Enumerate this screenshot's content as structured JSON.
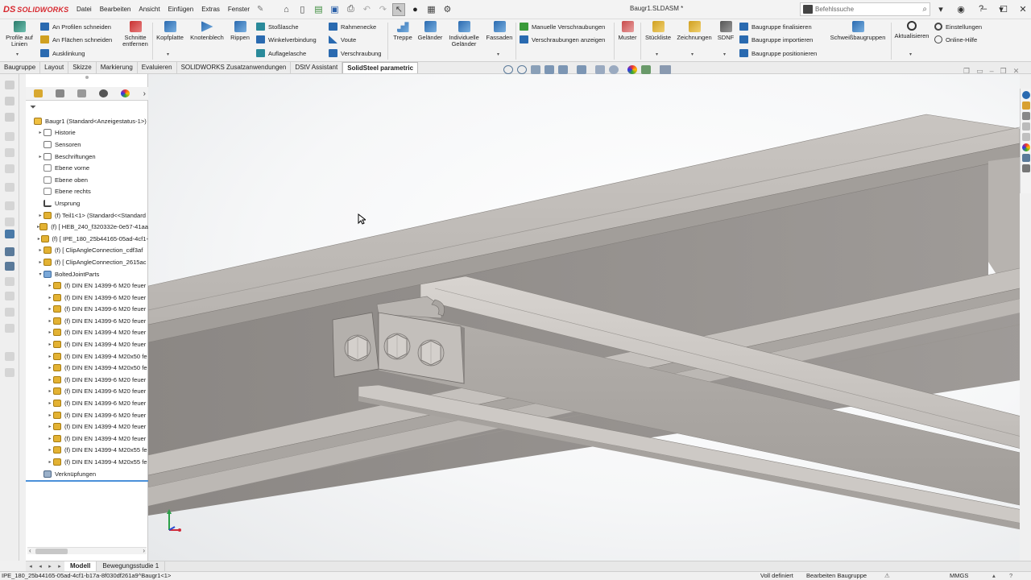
{
  "app": {
    "brand_ds": "DS",
    "brand_name": "SOLIDWORKS",
    "document_title": "Baugr1.SLDASM *",
    "search_placeholder": "Befehlssuche"
  },
  "menus": [
    "Datei",
    "Bearbeiten",
    "Ansicht",
    "Einfügen",
    "Extras",
    "Fenster"
  ],
  "ribbon": {
    "profile_from_lines": "Profile auf Linien",
    "cut_at_profiles": "An Profilen schneiden",
    "cut_at_faces": "An Flächen schneiden",
    "notch": "Ausklinkung",
    "remove_cuts": "Schnitte entfernen",
    "end_plate": "Kopfplatte",
    "gusset": "Knotenblech",
    "ribs": "Rippen",
    "splice": "Stoßlasche",
    "angle_connection": "Winkelverbindung",
    "bearing_plate": "Auflagelasche",
    "frame_corner": "Rahmenecke",
    "haunch": "Voute",
    "bracing": "Verschraubung",
    "stairs": "Treppe",
    "railing": "Geländer",
    "individual_railing": "Individuelle Geländer",
    "facades": "Fassaden",
    "manual_bolting": "Manuelle Verschraubungen",
    "show_bolting": "Verschraubungen anzeigen",
    "pattern": "Muster",
    "parts_list": "Stückliste",
    "drawings": "Zeichnungen",
    "sdnf": "SDNF",
    "finalize_assembly": "Baugruppe finalisieren",
    "import_assembly": "Baugruppe importieren",
    "position_assembly": "Baugruppe positionieren",
    "weld_assemblies": "Schweißbaugruppen",
    "update": "Aktualisieren",
    "settings": "Einstellungen",
    "online_help": "Online-Hilfe"
  },
  "command_tabs": [
    "Baugruppe",
    "Layout",
    "Skizze",
    "Markierung",
    "Evaluieren",
    "SOLIDWORKS Zusatzanwendungen",
    "DStV Assistant",
    "SolidSteel parametric"
  ],
  "active_command_tab": "SolidSteel parametric",
  "tree": [
    {
      "label": "Baugr1  (Standard<Anzeigestatus-1>)",
      "icon": "assembly-icon",
      "arrow": "",
      "indent": 0
    },
    {
      "label": "Historie",
      "icon": "history-icon",
      "arrow": "▸",
      "indent": 1
    },
    {
      "label": "Sensoren",
      "icon": "sensor-icon",
      "arrow": "",
      "indent": 1
    },
    {
      "label": "Beschriftungen",
      "icon": "annotation-icon",
      "arrow": "▸",
      "indent": 1
    },
    {
      "label": "Ebene vorne",
      "icon": "plane-icon",
      "arrow": "",
      "indent": 1
    },
    {
      "label": "Ebene oben",
      "icon": "plane-icon",
      "arrow": "",
      "indent": 1
    },
    {
      "label": "Ebene rechts",
      "icon": "plane-icon",
      "arrow": "",
      "indent": 1
    },
    {
      "label": "Ursprung",
      "icon": "origin-icon",
      "arrow": "",
      "indent": 1
    },
    {
      "label": "(f) Teil1<1> (Standard<<Standard",
      "icon": "part-icon",
      "arrow": "▸",
      "indent": 1
    },
    {
      "label": "(f) [ HEB_240_f320332e-0e57-41aa",
      "icon": "part-icon",
      "arrow": "▸",
      "indent": 1
    },
    {
      "label": "(f) [ IPE_180_25b44165-05ad-4cf1-",
      "icon": "part-icon",
      "arrow": "▸",
      "indent": 1
    },
    {
      "label": "(f) [ ClipAngleConnection_cdf3af",
      "icon": "part-icon",
      "arrow": "▸",
      "indent": 1
    },
    {
      "label": "(f) [ ClipAngleConnection_2615ac",
      "icon": "part-icon",
      "arrow": "▸",
      "indent": 1
    },
    {
      "label": "BoltedJointParts",
      "icon": "folder-icon",
      "arrow": "▾",
      "indent": 1
    },
    {
      "label": "(f) DIN EN 14399-6 M20 feuer",
      "icon": "part-icon",
      "arrow": "▸",
      "indent": 2
    },
    {
      "label": "(f) DIN EN 14399-6 M20 feuer",
      "icon": "part-icon",
      "arrow": "▸",
      "indent": 2
    },
    {
      "label": "(f) DIN EN 14399-6 M20 feuer",
      "icon": "part-icon",
      "arrow": "▸",
      "indent": 2
    },
    {
      "label": "(f) DIN EN 14399-6 M20 feuer",
      "icon": "part-icon",
      "arrow": "▸",
      "indent": 2
    },
    {
      "label": "(f) DIN EN 14399-4 M20 feuer",
      "icon": "part-icon",
      "arrow": "▸",
      "indent": 2
    },
    {
      "label": "(f) DIN EN 14399-4 M20 feuer",
      "icon": "part-icon",
      "arrow": "▸",
      "indent": 2
    },
    {
      "label": "(f) DIN EN 14399-4 M20x50 fe",
      "icon": "part-icon",
      "arrow": "▸",
      "indent": 2
    },
    {
      "label": "(f) DIN EN 14399-4 M20x50 fe",
      "icon": "part-icon",
      "arrow": "▸",
      "indent": 2
    },
    {
      "label": "(f) DIN EN 14399-6 M20 feuer",
      "icon": "part-icon",
      "arrow": "▸",
      "indent": 2
    },
    {
      "label": "(f) DIN EN 14399-6 M20 feuer",
      "icon": "part-icon",
      "arrow": "▸",
      "indent": 2
    },
    {
      "label": "(f) DIN EN 14399-6 M20 feuer",
      "icon": "part-icon",
      "arrow": "▸",
      "indent": 2
    },
    {
      "label": "(f) DIN EN 14399-6 M20 feuer",
      "icon": "part-icon",
      "arrow": "▸",
      "indent": 2
    },
    {
      "label": "(f) DIN EN 14399-4 M20 feuer",
      "icon": "part-icon",
      "arrow": "▸",
      "indent": 2
    },
    {
      "label": "(f) DIN EN 14399-4 M20 feuer",
      "icon": "part-icon",
      "arrow": "▸",
      "indent": 2
    },
    {
      "label": "(f) DIN EN 14399-4 M20x55 fe",
      "icon": "part-icon",
      "arrow": "▸",
      "indent": 2
    },
    {
      "label": "(f) DIN EN 14399-4 M20x55 fe",
      "icon": "part-icon",
      "arrow": "▸",
      "indent": 2
    },
    {
      "label": "Verknüpfungen",
      "icon": "mates-icon",
      "arrow": "",
      "indent": 1
    }
  ],
  "bottom_tabs": [
    "Modell",
    "Bewegungsstudie 1"
  ],
  "active_bottom_tab": "Modell",
  "status": {
    "selection": "IPE_180_25b44165-05ad-4cf1-b17a-8f030df261a9^Baugr1<1>",
    "definition": "Voll definiert",
    "mode": "Bearbeiten Baugruppe",
    "units": "MMGS"
  },
  "colors": {
    "brand_red": "#d7282f",
    "steel_light": "#c9c5c1",
    "steel_mid": "#a9a5a1",
    "steel_dark": "#7e7a77",
    "selection_blue": "#4a90d9"
  }
}
